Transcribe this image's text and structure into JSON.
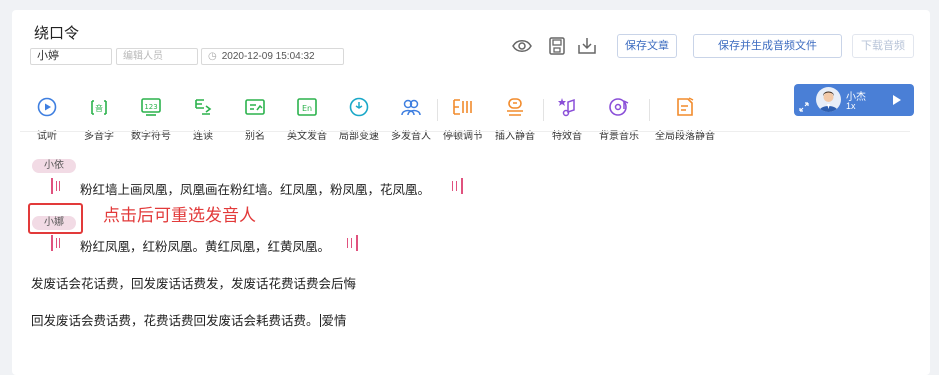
{
  "header": {
    "title": "绕口令",
    "speaker_value": "小婷",
    "editor_placeholder": "编辑人员",
    "datetime": "2020-12-09 15:04:32"
  },
  "actions": {
    "save_article": "保存文章",
    "save_and_generate": "保存并生成音频文件",
    "download_audio": "下载音频"
  },
  "toolbar": [
    {
      "label": "试听",
      "icon": "play-circle-icon"
    },
    {
      "label": "多音字",
      "icon": "polyphone-icon"
    },
    {
      "label": "数字符号",
      "icon": "number-symbol-icon"
    },
    {
      "label": "连读",
      "icon": "liaison-icon"
    },
    {
      "label": "别名",
      "icon": "alias-icon"
    },
    {
      "label": "英文发音",
      "icon": "english-icon"
    },
    {
      "label": "局部变速",
      "icon": "local-speed-icon"
    },
    {
      "label": "多发音人",
      "icon": "multi-speaker-icon"
    },
    {
      "label": "停顿调节",
      "icon": "pause-adjust-icon"
    },
    {
      "label": "插入静音",
      "icon": "insert-silence-icon"
    },
    {
      "label": "特效音",
      "icon": "sound-effect-icon"
    },
    {
      "label": "背景音乐",
      "icon": "background-music-icon"
    },
    {
      "label": "全局段落静音",
      "icon": "global-paragraph-silence-icon"
    }
  ],
  "voice": {
    "name": "小杰",
    "speed": "1x"
  },
  "content": {
    "segments": [
      {
        "speaker": "小依",
        "text": "粉红墙上画凤凰，凤凰画在粉红墙。红凤凰，粉凤凰，花凤凰。"
      },
      {
        "speaker": "小娜",
        "text": "粉红凤凰，红粉凤凰。黄红凤凰，红黄凤凰。"
      }
    ],
    "paragraph_1": "发废话会花话费，回发废话话费发，发废话花费话费会后悔",
    "paragraph_2_before_cursor": "回发废话会费话费，花费话费回发废话会耗费话费。",
    "paragraph_2_after_cursor": "爱情"
  },
  "annotation": "点击后可重选发音人",
  "colors": {
    "accent": "#3d6cc0",
    "icon_green": "#2bb24c",
    "icon_blue": "#3f7fe0",
    "icon_purple": "#8a4fd8",
    "icon_orange": "#f28b2c",
    "voice_card": "#4a7fd6",
    "speaker_tag": "#f2dbe5",
    "marker_pink": "#e0527e",
    "annotation_red": "#e23a3a"
  }
}
